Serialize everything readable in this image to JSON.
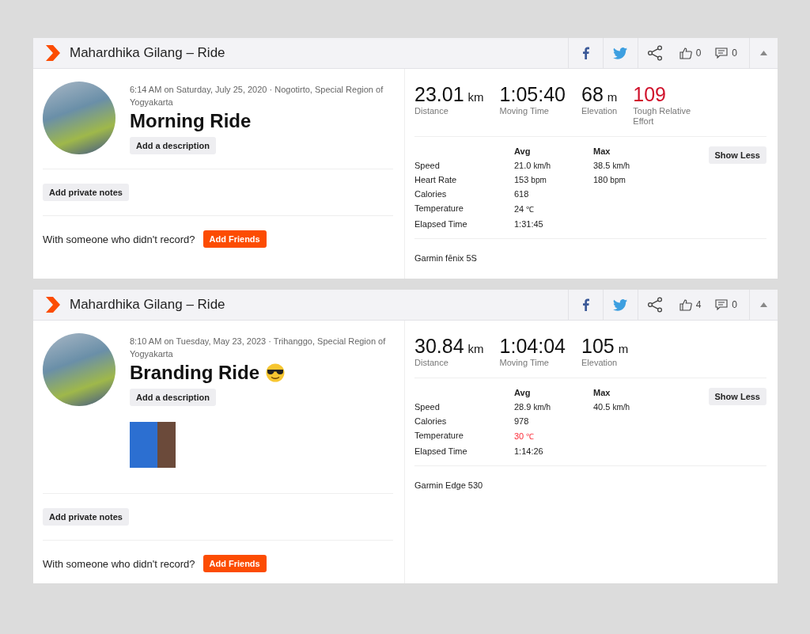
{
  "activities": [
    {
      "title": "Mahardhika Gilang – Ride",
      "likes": "0",
      "comments": "0",
      "meta": "6:14 AM on Saturday, July 25, 2020 · Nogotirto, Special Region of Yogyakarta",
      "name": "Morning Ride",
      "emoji_icon": false,
      "description_button": "Add a description",
      "has_photo": false,
      "notes_button": "Add private notes",
      "friends_prompt": "With someone who didn't record?",
      "friends_button": "Add Friends",
      "stats": [
        {
          "value": "23.01",
          "unit": "km",
          "label": "Distance",
          "highlighted": false
        },
        {
          "value": "1:05:40",
          "label": "Moving Time",
          "highlighted": false
        },
        {
          "value": "68",
          "unit": "m",
          "label": "Elevation",
          "highlighted": false
        },
        {
          "value": "109",
          "label": "Tough Relative Effort",
          "highlighted": true
        }
      ],
      "columns": [
        "Avg",
        "Max"
      ],
      "toggle_button": "Show Less",
      "details": [
        {
          "label": "Speed",
          "avg": "21.0",
          "avg_unit": "km/h",
          "max": "38.5",
          "max_unit": "km/h",
          "warning": false
        },
        {
          "label": "Heart Rate",
          "avg": "153",
          "avg_unit": "bpm",
          "max": "180",
          "max_unit": "bpm",
          "warning": false
        },
        {
          "label": "Calories",
          "avg": "618",
          "warning": false
        },
        {
          "label": "Temperature",
          "avg": "24",
          "avg_unit": "℃",
          "warning": false
        },
        {
          "label": "Elapsed Time",
          "avg": "1:31:45",
          "warning": false
        }
      ],
      "device": "Garmin fēnix 5S"
    },
    {
      "title": "Mahardhika Gilang – Ride",
      "likes": "4",
      "comments": "0",
      "meta": "8:10 AM on Tuesday, May 23, 2023 · Trihanggo, Special Region of Yogyakarta",
      "name": "Branding Ride",
      "emoji_icon": true,
      "description_button": "Add a description",
      "has_photo": true,
      "notes_button": "Add private notes",
      "friends_prompt": "With someone who didn't record?",
      "friends_button": "Add Friends",
      "stats": [
        {
          "value": "30.84",
          "unit": "km",
          "label": "Distance",
          "highlighted": false
        },
        {
          "value": "1:04:04",
          "label": "Moving Time",
          "highlighted": false
        },
        {
          "value": "105",
          "unit": "m",
          "label": "Elevation",
          "highlighted": false
        }
      ],
      "columns": [
        "Avg",
        "Max"
      ],
      "toggle_button": "Show Less",
      "details": [
        {
          "label": "Speed",
          "avg": "28.9",
          "avg_unit": "km/h",
          "max": "40.5",
          "max_unit": "km/h",
          "warning": false
        },
        {
          "label": "Calories",
          "avg": "978",
          "warning": false
        },
        {
          "label": "Temperature",
          "avg": "30",
          "avg_unit": "℃",
          "warning": true
        },
        {
          "label": "Elapsed Time",
          "avg": "1:14:26",
          "warning": false
        }
      ],
      "device": "Garmin Edge 530"
    }
  ]
}
